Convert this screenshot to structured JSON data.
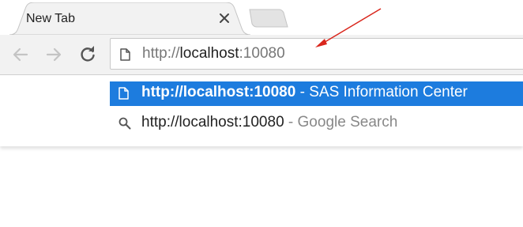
{
  "tab": {
    "title": "New Tab",
    "close_icon": "close-icon"
  },
  "toolbar": {
    "back_icon": "back-arrow-icon",
    "forward_icon": "forward-arrow-icon",
    "reload_icon": "reload-icon"
  },
  "omnibox": {
    "page_icon": "page-icon",
    "url_scheme": "http://",
    "url_host": "localhost",
    "url_port": ":10080"
  },
  "suggestions": [
    {
      "icon": "page-icon",
      "url": "http://localhost:10080",
      "separator": "-",
      "description": "SAS Information Center",
      "selected": true
    },
    {
      "icon": "search-icon",
      "url": "http://localhost:10080",
      "separator": "-",
      "description": "Google Search",
      "selected": false
    }
  ],
  "colors": {
    "selection": "#1d7cde",
    "toolbar_bg": "#f2f2f2",
    "annotation_arrow": "#d9261c"
  }
}
